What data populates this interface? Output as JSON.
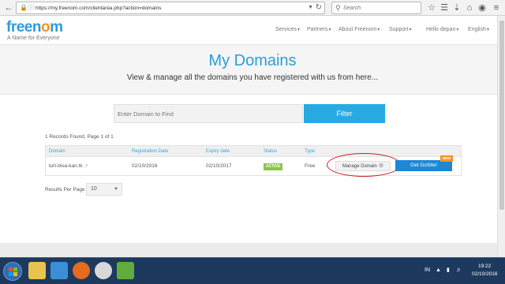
{
  "browser": {
    "url": "https://my.freenom.com/clientarea.php?action=domains",
    "search_placeholder": "Search"
  },
  "header": {
    "logo": "freenom",
    "logo_o": "o",
    "tagline": "A Name for Everyone",
    "nav": {
      "services": "Services",
      "partners": "Partners",
      "about": "About Freenom",
      "support": "Support",
      "user": "Hello depan",
      "language": "English"
    }
  },
  "hero": {
    "title": "My Domains",
    "subtitle": "View & manage all the domains you have registered with us from here..."
  },
  "filter": {
    "placeholder": "Enter Domain to Find",
    "button": "Filter"
  },
  "records_text": "1 Records Found, Page 1 of 1",
  "table": {
    "headers": {
      "domain": "Domain",
      "registration_date": "Registration Date",
      "expiry_date": "Expiry date",
      "status": "Status",
      "type": "Type"
    },
    "rows": [
      {
        "domain": "tuh-bisa-kan.tk",
        "registration_date": "02/10/2016",
        "expiry_date": "02/10/2017",
        "status": "ACTIVE",
        "type": "Free",
        "manage": "Manage Domain",
        "gosite": "Get GoSite!",
        "new_badge": "NEW"
      }
    ]
  },
  "results_per_page": {
    "label": "Results Per Page",
    "value": "10"
  },
  "taskbar": {
    "lang": "IN",
    "time": "19:22",
    "date": "02/10/2016"
  },
  "colors": {
    "brand_blue": "#27aae1",
    "logo_orange": "#f7941d",
    "active_green": "#8cc63f",
    "annotation_red": "#c42323"
  }
}
